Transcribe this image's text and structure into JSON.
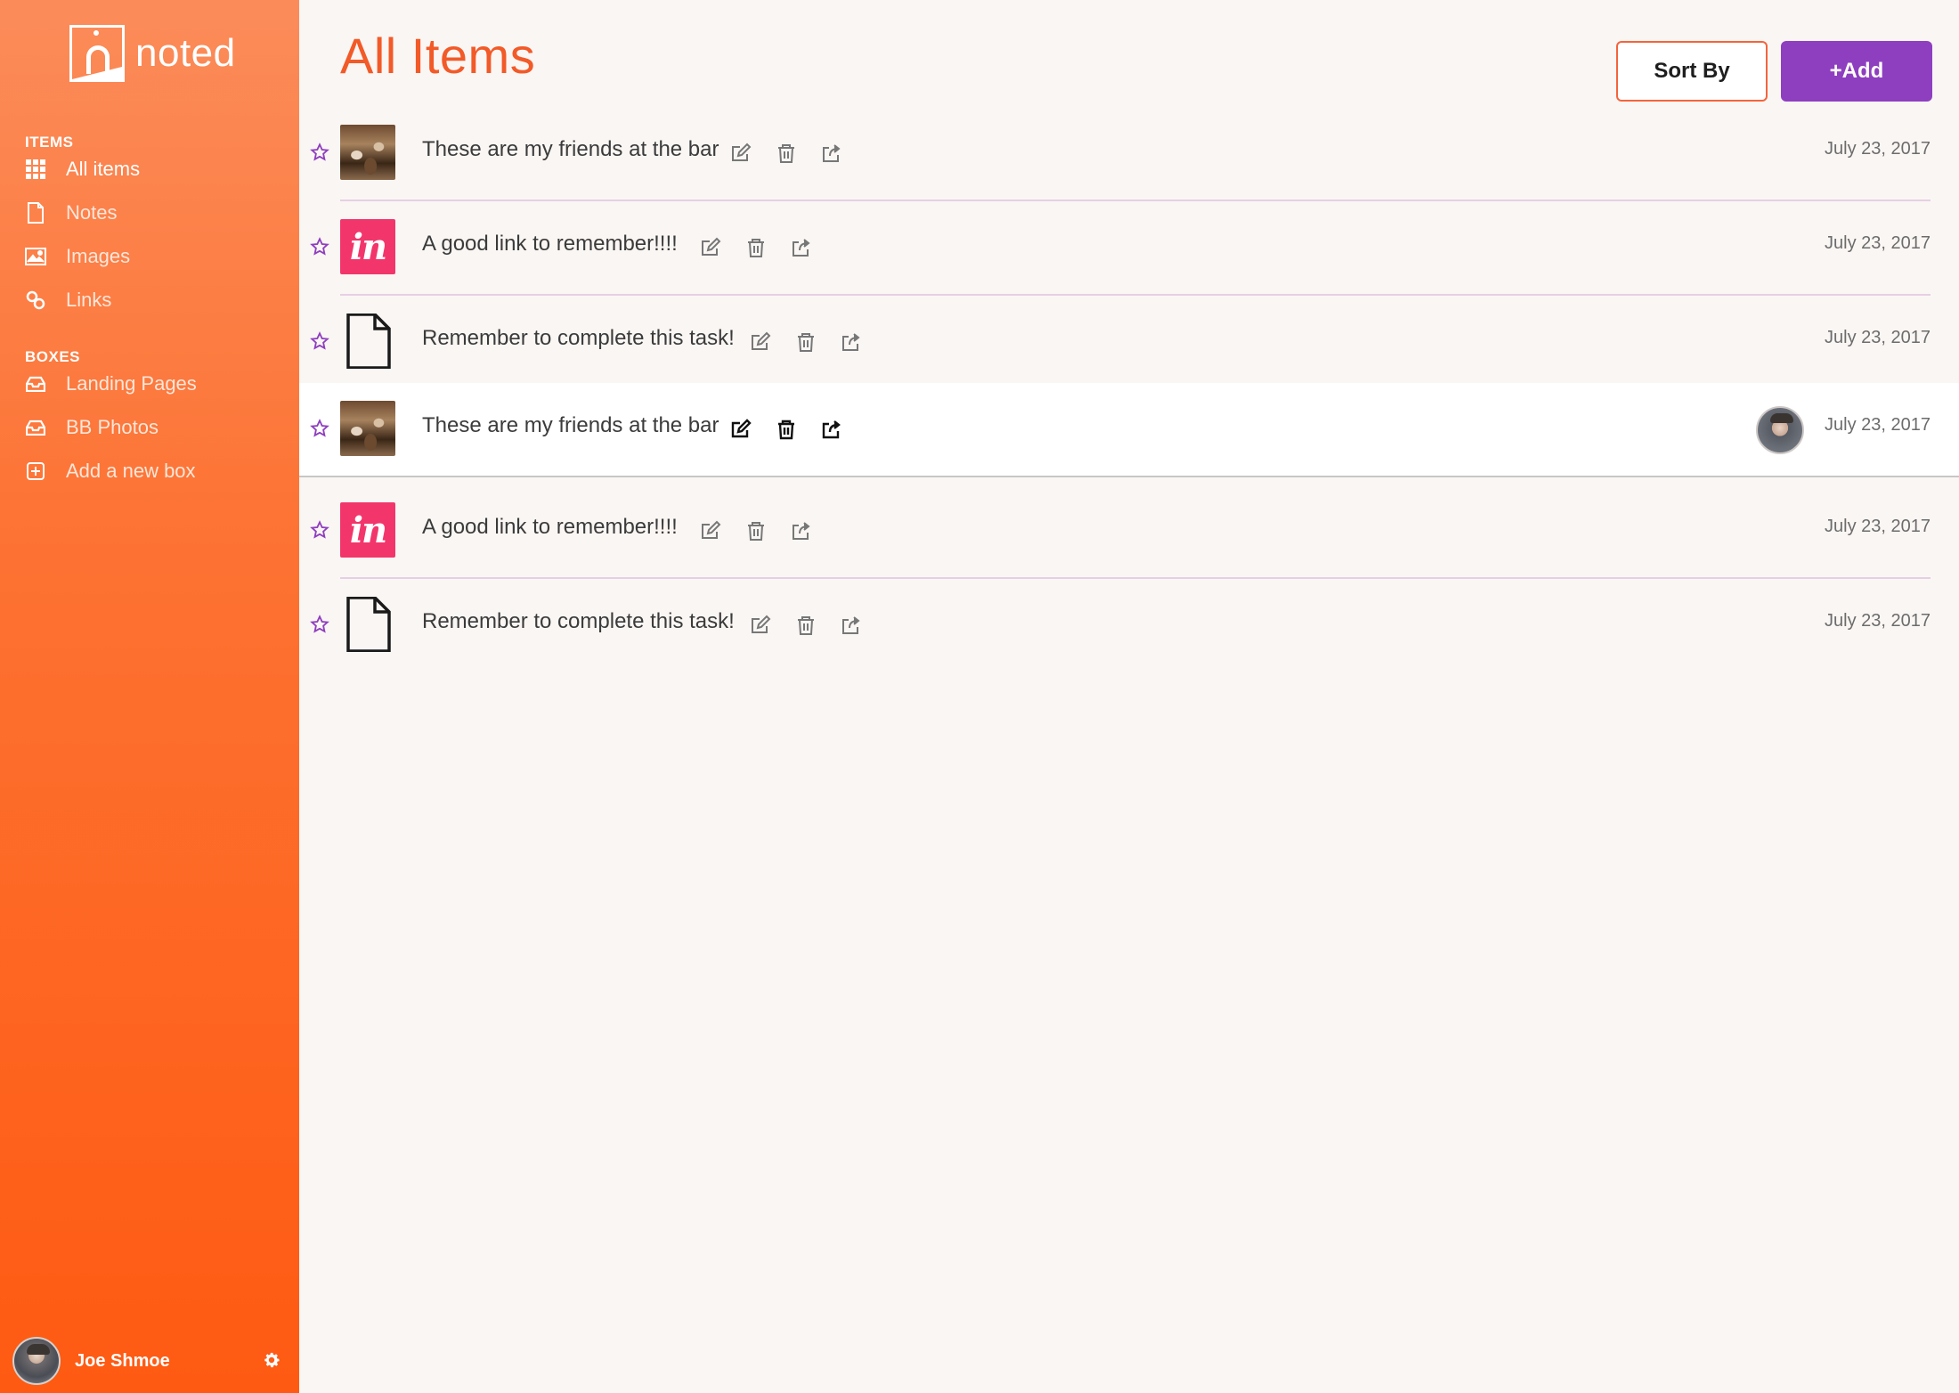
{
  "brand": {
    "name": "noted"
  },
  "sidebar": {
    "items_label": "ITEMS",
    "items": [
      {
        "label": "All items",
        "icon": "grid-icon"
      },
      {
        "label": "Notes",
        "icon": "document-icon"
      },
      {
        "label": "Images",
        "icon": "image-icon"
      },
      {
        "label": "Links",
        "icon": "link-icon"
      }
    ],
    "boxes_label": "BOXES",
    "boxes": [
      {
        "label": "Landing Pages",
        "icon": "inbox-icon"
      },
      {
        "label": "BB Photos",
        "icon": "inbox-icon"
      },
      {
        "label": "Add a new box",
        "icon": "plus-square-icon"
      }
    ]
  },
  "user": {
    "name": "Joe Shmoe"
  },
  "main": {
    "title": "All Items",
    "sort_label": "Sort By",
    "add_label": "+Add"
  },
  "items": [
    {
      "title": "These are my friends at the bar",
      "date": "July 23, 2017",
      "thumb": "photo"
    },
    {
      "title": "A good link to remember!!!!",
      "date": "July 23, 2017",
      "thumb": "invision",
      "thumb_text": "in"
    },
    {
      "title": "Remember to complete this task!",
      "date": "July 23, 2017",
      "thumb": "doc"
    },
    {
      "title": "These are my friends at the bar",
      "date": "July 23, 2017",
      "thumb": "photo",
      "selected": true
    },
    {
      "title": "A good link to remember!!!!",
      "date": "July 23, 2017",
      "thumb": "invision",
      "thumb_text": "in"
    },
    {
      "title": "Remember to complete this task!",
      "date": "July 23, 2017",
      "thumb": "doc"
    }
  ],
  "colors": {
    "accent": "#f25a28",
    "add_button": "#8e3fbf",
    "star": "#8e3fbf",
    "invision": "#f2366b"
  }
}
